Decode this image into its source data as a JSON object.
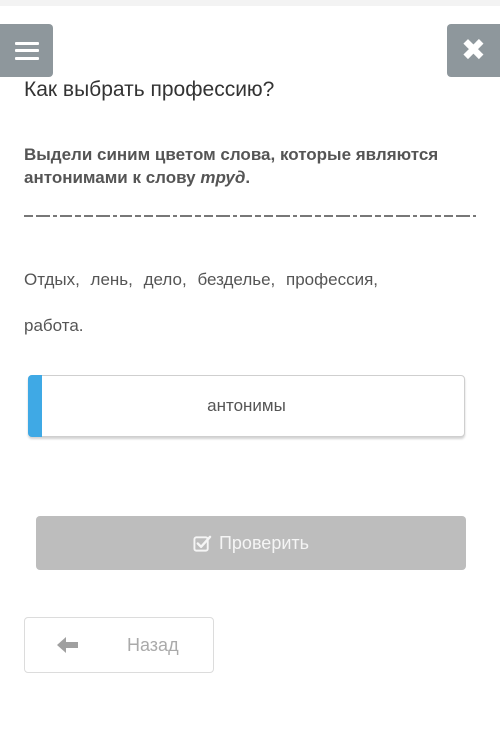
{
  "header": {
    "menu_icon": "hamburger-icon",
    "close_icon": "close-icon",
    "close_glyph": "✖"
  },
  "lesson": {
    "title": "Как выбрать профессию?",
    "instruction_prefix": "Выдели синим цветом слова, которые являются антонимами к слову ",
    "instruction_keyword": "труд",
    "instruction_suffix": "."
  },
  "words_line1": [
    "Отдых,",
    "лень,",
    "дело,",
    "безделье,",
    "профессия,"
  ],
  "words_line2": "работа.",
  "answer_box": {
    "label": "антонимы",
    "accent_color": "#3fa9e5"
  },
  "check_button": {
    "label": "Проверить",
    "icon": "checkbox-icon"
  },
  "back_button": {
    "label": "Назад",
    "icon": "arrow-left-icon"
  }
}
